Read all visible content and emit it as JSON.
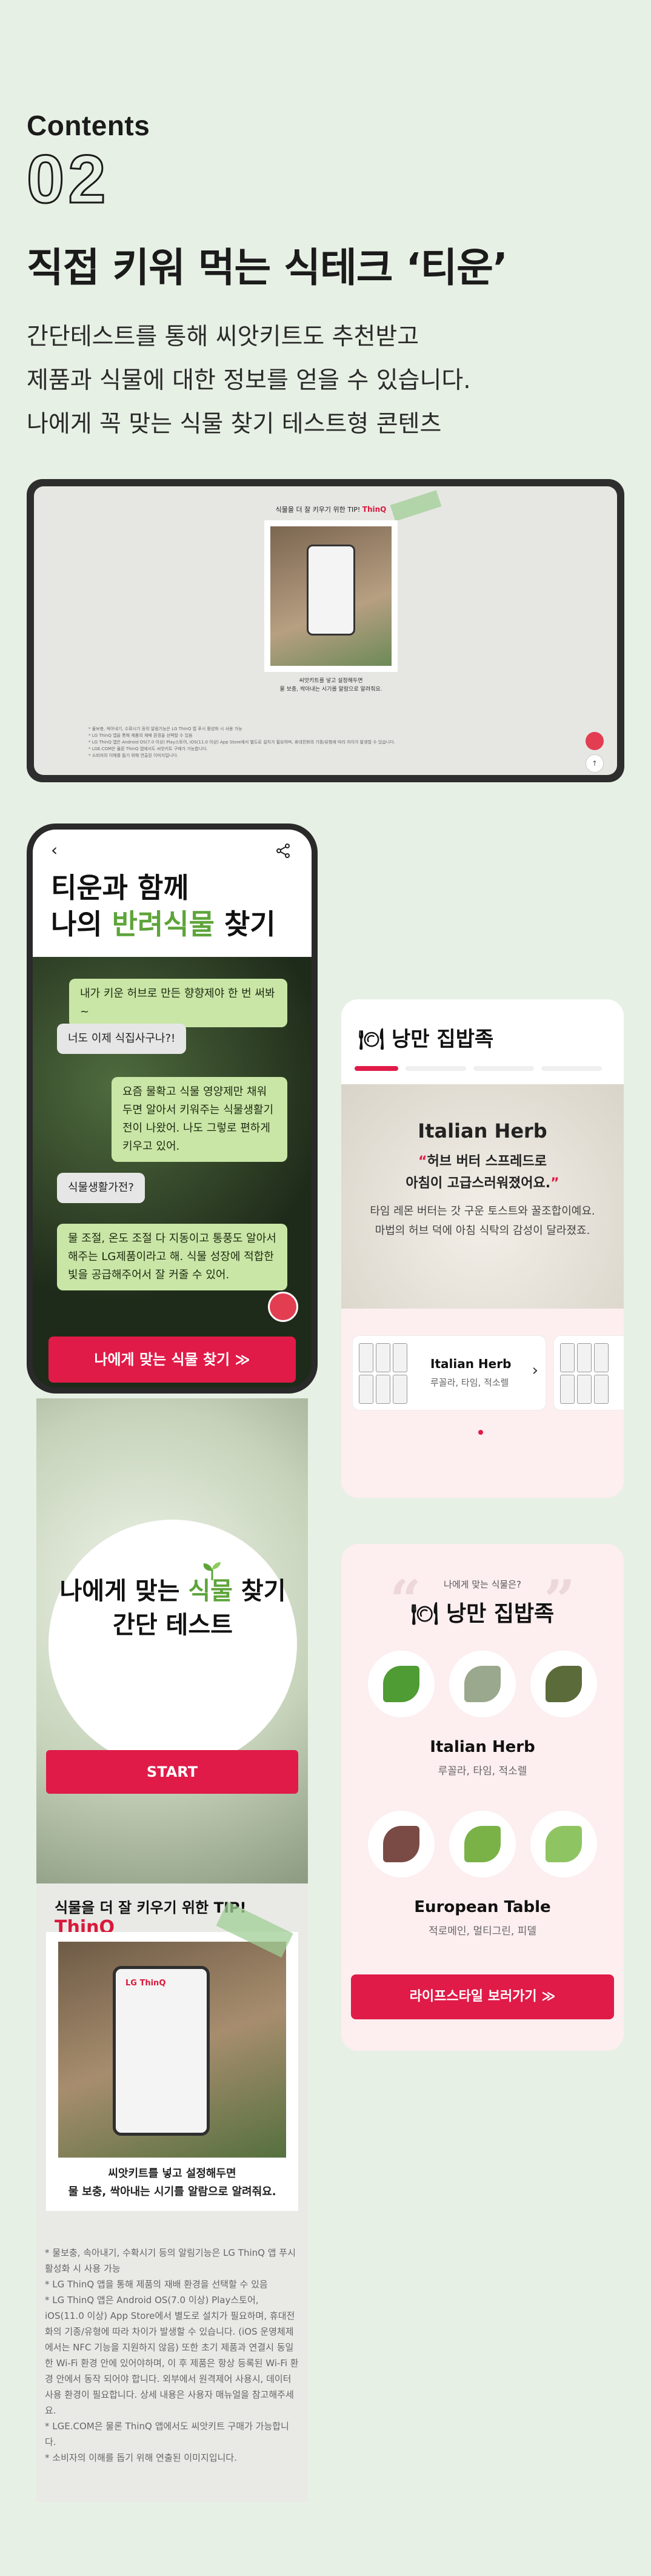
{
  "header": {
    "label": "Contents",
    "number": "02",
    "title": "직접 키워 먹는 식테크 ‘티운’",
    "description": [
      "간단테스트를 통해 씨앗키트도 추천받고",
      "제품과 식물에 대한 정보를 얻을 수 있습니다.",
      "나에게 꼭 맞는 식물 찾기 테스트형 콘텐츠"
    ]
  },
  "tablet": {
    "card_title": "식물을 더 잘 키우기 위한 TIP!",
    "thinq": "ThinQ",
    "caption": [
      "씨앗키트를 넣고 설정해두면",
      "물 보충, 싹아내는 시기를 알람으로 알려줘요."
    ],
    "notes": [
      "* 물보충, 싹아내기, 수확시기 등의 알림기능은 LG ThinQ 앱 푸시 활성화 시 사용 가능",
      "* LG ThinQ 앱을 통해 제품의 재배 환경을 선택할 수 있음",
      "* LG ThinQ 앱은 Android OS(7.0 이상) Play스토어, iOS(11.0 이상) App Store에서 별도로 설치가 필요하며, 휴대전화의 기종/유형에 따라 차이가 발생할 수 있습니다.",
      "* LGE.COM은 물론 ThinQ 앱에서도 씨앗키트 구매가 가능합니다.",
      "* 소비자의 이해를 돕기 위해 연출된 이미지입니다."
    ]
  },
  "phone": {
    "title_line1": "티운과 함께",
    "title_line2_pre": "나의 ",
    "title_line2_green": "반려식물",
    "title_line2_post": " 찾기",
    "chat": [
      "내가 키운 허브로 만든 향향제야 한 번 써봐~",
      "너도 이제 식집사구나?!",
      "요즘 물확고 식물 영양제만 채워두면 알아서 키워주는 식물생활기전이 나왔어. 나도 그렇로 편하게 키우고 있어.",
      "식물생활가전?",
      "물 조절, 온도 조절 다 지동이고 통풍도 알아서 해주는 LG제품이라고 해. 식물 성장에 적합한 빛을 공급해주어서 잘 커줄 수 있어."
    ],
    "cta": "나에게 맞는 식물 찾기 ≫"
  },
  "test": {
    "line1_pre": "나에게 맞는 ",
    "line1_green": "식물",
    "line1_post": " 찾기",
    "line2": "간단 테스트",
    "start": "START"
  },
  "tips": {
    "title": "식물을 더 잘 키우기 위한 TIP!",
    "thinq": "ThinQ",
    "phone_logo": "LG ThinQ",
    "caption": [
      "씨앗키트를 넣고 설정해두면",
      "물 보충, 싹아내는 시기를 알람으로 알려줘요."
    ],
    "notes": [
      "* 물보충, 속아내기, 수확시기 등의 알림기능은 LG ThinQ 앱 푸시 활성화 시 사용 가능",
      "* LG ThinQ 앱을 통해 제품의 재배 환경을 선택할 수 있음",
      "* LG ThinQ 앱은 Android OS(7.0 이상) Play스토어, iOS(11.0 이상) App Store에서 별도로 설치가 필요하며, 휴대전화의 기종/유형에 따라 차이가 발생할 수 있습니다. (iOS 운영체제에서는 NFC 기능을 지원하지 않음) 또한 초기 제품과 연결시 동일한 Wi-Fi 환경 안에 있어야하며, 이 후 제품은 항상 등록된 Wi-Fi 환경 안에서 동작 되어야 합니다. 외부에서 원격제어 사용시, 데이터 사용 환경이 필요합니다. 상세 내용은 사용자 매뉴얼을 참고해주세요.",
      "* LGE.COM은 물론 ThinQ 앱에서도 씨앗키트 구매가 가능합니다.",
      "* 소비자의 이해를 돕기 위해 연출된 이미지입니다."
    ]
  },
  "result": {
    "title": "낭만 집밥족",
    "herb_name": "Italian Herb",
    "quote_line1": "허브 버터 스프레드로",
    "quote_line2": "아침이 고급스러워졌어요.",
    "desc_line1": "타임 레몬 버터는 갓 구운 토스트와 꿀조합이예요.",
    "desc_line2": "마법의 허브 덕에 아침 식탁의 감성이 달라졌죠.",
    "product_name": "Italian Herb",
    "product_sub": "루꼴라, 타임, 적소렐"
  },
  "recommend": {
    "small": "나에게 맞는 식물은?",
    "title": "낭만 집밥족",
    "group1_name": "Italian Herb",
    "group1_sub": "루꼴라, 타임, 적소렐",
    "group2_name": "European Table",
    "group2_sub": "적로메인, 멀티그린, 피델",
    "button": "라이프스타일 보러가기 ≫"
  },
  "colors": {
    "background": "#e7f0e4",
    "accent_red": "#e01b48",
    "accent_green": "#5ea43a",
    "bubble_green": "#c9e6a6",
    "pink_panel": "#fdeef0"
  },
  "icons": [
    "back-arrow-icon",
    "share-icon",
    "chevron-right-icon",
    "fork-knife-icon",
    "sprout-icon"
  ]
}
